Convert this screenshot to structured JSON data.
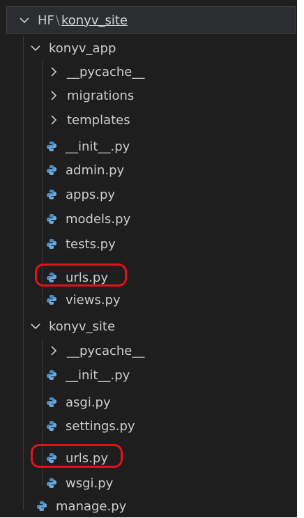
{
  "explorer": {
    "root": {
      "folder_label": "HF",
      "separator": "\\",
      "project_label": "konyv_site"
    },
    "icons": {
      "folder_open": "chevron-down-icon",
      "folder_closed": "chevron-right-icon",
      "python_file": "python-file-icon"
    },
    "colors": {
      "background": "#1e1e1e",
      "text": "#cccccc",
      "highlight": "#e3111b",
      "python_icon": "#4b8bbe"
    },
    "items": [
      {
        "label": "konyv_app",
        "type": "folder-open"
      },
      {
        "label": "__pycache__",
        "type": "folder-closed"
      },
      {
        "label": "migrations",
        "type": "folder-closed"
      },
      {
        "label": "templates",
        "type": "folder-closed"
      },
      {
        "label": "__init__.py",
        "type": "python"
      },
      {
        "label": "admin.py",
        "type": "python"
      },
      {
        "label": "apps.py",
        "type": "python"
      },
      {
        "label": "models.py",
        "type": "python"
      },
      {
        "label": "tests.py",
        "type": "python"
      },
      {
        "label": "urls.py",
        "type": "python",
        "highlighted": true
      },
      {
        "label": "views.py",
        "type": "python"
      },
      {
        "label": "konyv_site",
        "type": "folder-open"
      },
      {
        "label": "__pycache__",
        "type": "folder-closed"
      },
      {
        "label": "__init__.py",
        "type": "python"
      },
      {
        "label": "asgi.py",
        "type": "python"
      },
      {
        "label": "settings.py",
        "type": "python"
      },
      {
        "label": "urls.py",
        "type": "python",
        "highlighted": true
      },
      {
        "label": "wsgi.py",
        "type": "python"
      },
      {
        "label": "manage.py",
        "type": "python"
      }
    ]
  }
}
